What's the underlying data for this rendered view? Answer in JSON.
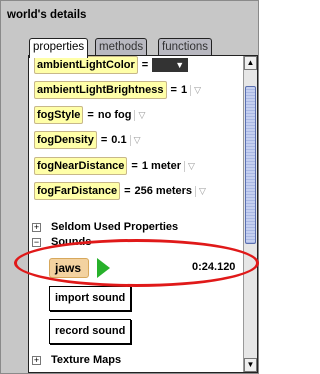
{
  "panel": {
    "title": "world's details",
    "tabs": [
      {
        "label": "properties",
        "active": true
      },
      {
        "label": "methods",
        "active": false
      },
      {
        "label": "functions",
        "active": false
      }
    ]
  },
  "properties": [
    {
      "name": "ambientLightColor",
      "value": "",
      "value_kind": "color",
      "color": "#333333"
    },
    {
      "name": "ambientLightBrightness",
      "value": "1"
    },
    {
      "name": "fogStyle",
      "value": "no fog"
    },
    {
      "name": "fogDensity",
      "value": "0.1"
    },
    {
      "name": "fogNearDistance",
      "value": "1 meter"
    },
    {
      "name": "fogFarDistance",
      "value": "256 meters"
    }
  ],
  "tree": {
    "seldom_used": {
      "expander": "+",
      "label": "Seldom Used Properties"
    },
    "sounds": {
      "expander": "−",
      "label": "Sounds"
    },
    "texture_maps": {
      "expander": "+",
      "label": "Texture Maps"
    }
  },
  "sound": {
    "name": "jaws",
    "duration": "0:24.120",
    "play_icon": "play-icon"
  },
  "buttons": {
    "import": "import sound",
    "record": "record sound"
  },
  "colors": {
    "property_tile": "#ffffa8",
    "sound_tile": "#f3d2a0",
    "play": "#27b12b",
    "highlight": "#e01919",
    "scroll_thumb": "#b7c3e8"
  }
}
